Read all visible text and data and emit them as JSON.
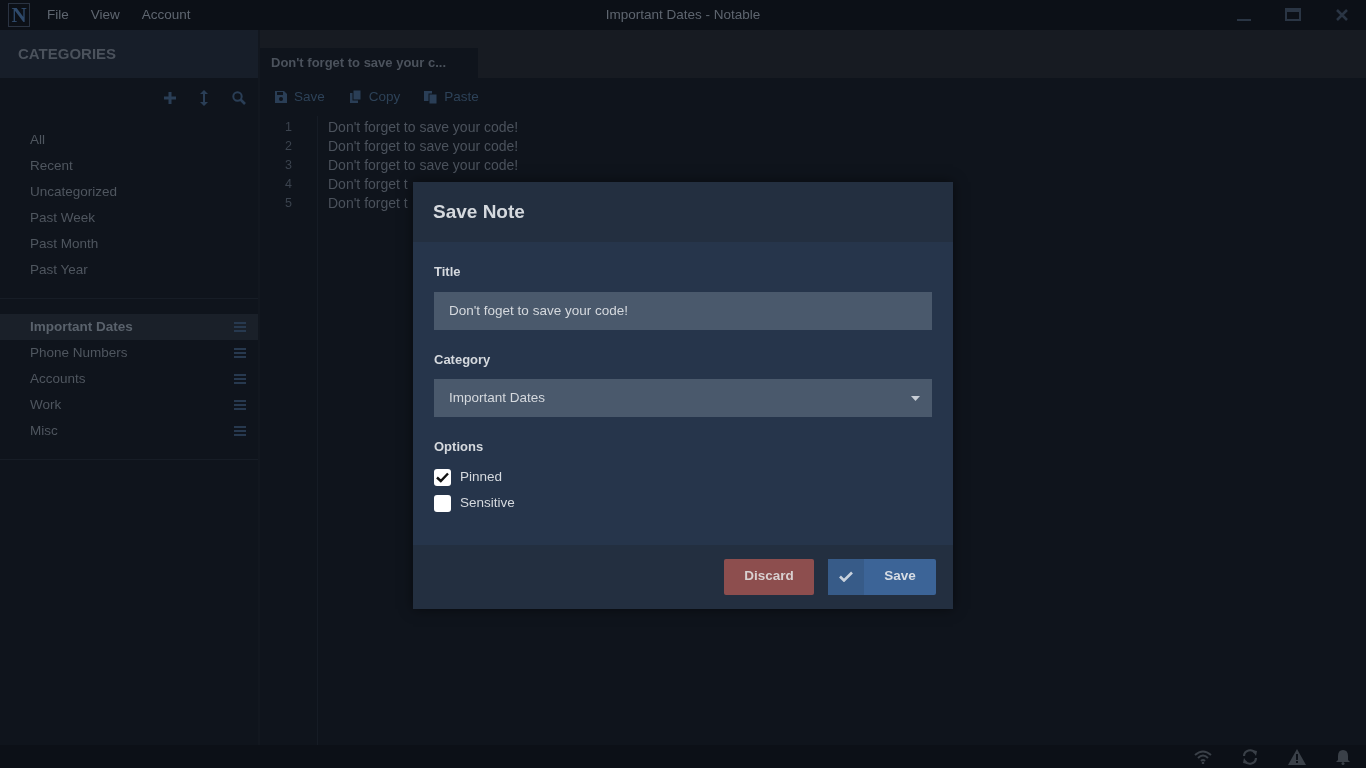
{
  "window": {
    "title": "Important Dates - Notable",
    "menu": [
      "File",
      "View",
      "Account"
    ],
    "logo": "N"
  },
  "sidebar": {
    "title": "CATEGORIES",
    "filters": [
      {
        "label": "All",
        "selected": false
      },
      {
        "label": "Recent",
        "selected": false
      },
      {
        "label": "Uncategorized",
        "selected": false
      },
      {
        "label": "Past Week",
        "selected": false
      },
      {
        "label": "Past Month",
        "selected": false
      },
      {
        "label": "Past Year",
        "selected": false
      }
    ],
    "categories": [
      {
        "label": "Important Dates",
        "selected": true
      },
      {
        "label": "Phone Numbers",
        "selected": false
      },
      {
        "label": "Accounts",
        "selected": false
      },
      {
        "label": "Work",
        "selected": false
      },
      {
        "label": "Misc",
        "selected": false
      }
    ]
  },
  "tabs": [
    {
      "label": "Don't forget to save your c...",
      "selected": true
    }
  ],
  "toolbar": [
    {
      "kind": "save",
      "label": "Save"
    },
    {
      "kind": "copy",
      "label": "Copy"
    },
    {
      "kind": "paste",
      "label": "Paste"
    }
  ],
  "editor": {
    "lines": [
      {
        "number": "1",
        "text": "Don't forget to save your code!"
      },
      {
        "number": "2",
        "text": "Don't forget to save your code!"
      },
      {
        "number": "3",
        "text": "Don't forget to save your code!"
      },
      {
        "number": "4",
        "text": "Don't forget t"
      },
      {
        "number": "5",
        "text": "Don't forget t"
      }
    ]
  },
  "dialog": {
    "title": "Save Note",
    "title_label": "Title",
    "title_value": "Don't foget to save your code!",
    "category_label": "Category",
    "category_value": "Important Dates",
    "options_label": "Options",
    "options": [
      {
        "label": "Pinned",
        "checked": true
      },
      {
        "label": "Sensitive",
        "checked": false
      }
    ],
    "buttons": [
      {
        "kind": "discard",
        "label": "Discard"
      },
      {
        "kind": "save",
        "label": "Save"
      }
    ]
  }
}
